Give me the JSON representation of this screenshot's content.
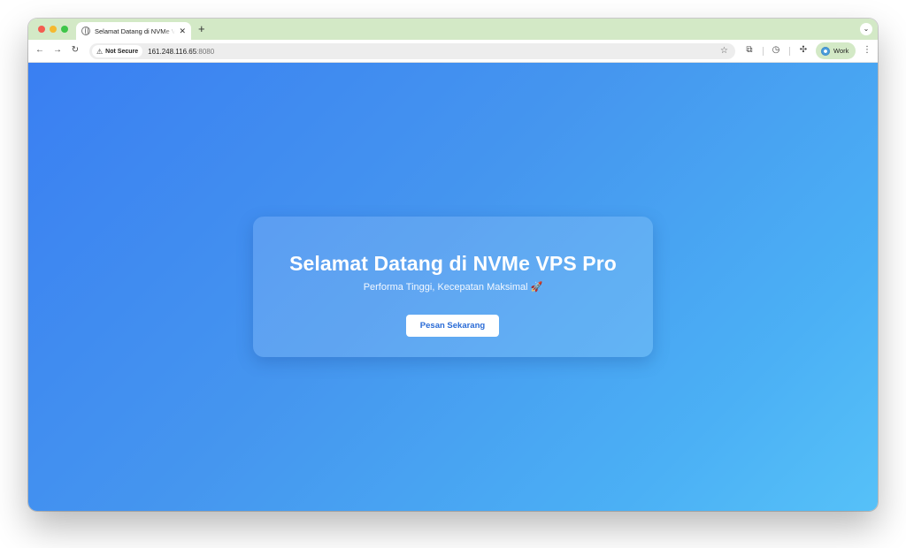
{
  "browser": {
    "tab": {
      "title": "Selamat Datang di NVMe VPS Pro",
      "close_glyph": "✕"
    },
    "new_tab_glyph": "+",
    "tab_menu_glyph": "⌄",
    "nav": {
      "back_glyph": "←",
      "forward_glyph": "→",
      "reload_glyph": "↻"
    },
    "omnibox": {
      "security_label": "Not Secure",
      "security_glyph": "⚠",
      "host": "161.248.116.65",
      "port": ":8080",
      "bookmark_glyph": "☆"
    },
    "toolbar_icons": {
      "extensions_glyph": "⧉",
      "history_glyph": "◷",
      "ai_glyph": "✣",
      "menu_glyph": "⋮"
    },
    "profile": {
      "label": "Work"
    }
  },
  "page": {
    "title": "Selamat Datang di NVMe VPS Pro",
    "subtitle": "Performa Tinggi, Kecepatan Maksimal 🚀",
    "cta_label": "Pesan Sekarang",
    "colors": {
      "gradient_start": "#3a7ff2",
      "gradient_end": "#56c1f8",
      "cta_text": "#2a6bd6"
    }
  }
}
